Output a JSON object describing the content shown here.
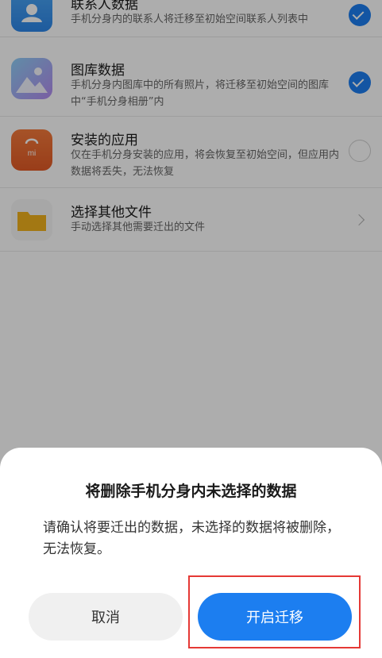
{
  "items": [
    {
      "title": "联系人数据",
      "desc": "手机分身内的联系人将迁移至初始空间联系人列表中",
      "checked": true,
      "icon": "contacts-icon"
    },
    {
      "title": "图库数据",
      "desc": "手机分身内图库中的所有照片，将迁移至初始空间的图库中“手机分身相册”内",
      "checked": true,
      "icon": "gallery-icon"
    },
    {
      "title": "安装的应用",
      "desc": "仅在手机分身安装的应用，将会恢复至初始空间，但应用内数据将丢失，无法恢复",
      "checked": false,
      "icon": "app-store-icon"
    },
    {
      "title": "选择其他文件",
      "desc": "手动选择其他需要迁出的文件",
      "icon": "folder-icon"
    }
  ],
  "dialog": {
    "title": "将删除手机分身内未选择的数据",
    "message": "请确认将要迁出的数据，未选择的数据将被删除，无法恢复。",
    "cancel_label": "取消",
    "confirm_label": "开启迁移"
  },
  "colors": {
    "accent": "#1c7ef0",
    "highlight": "#e53935"
  }
}
